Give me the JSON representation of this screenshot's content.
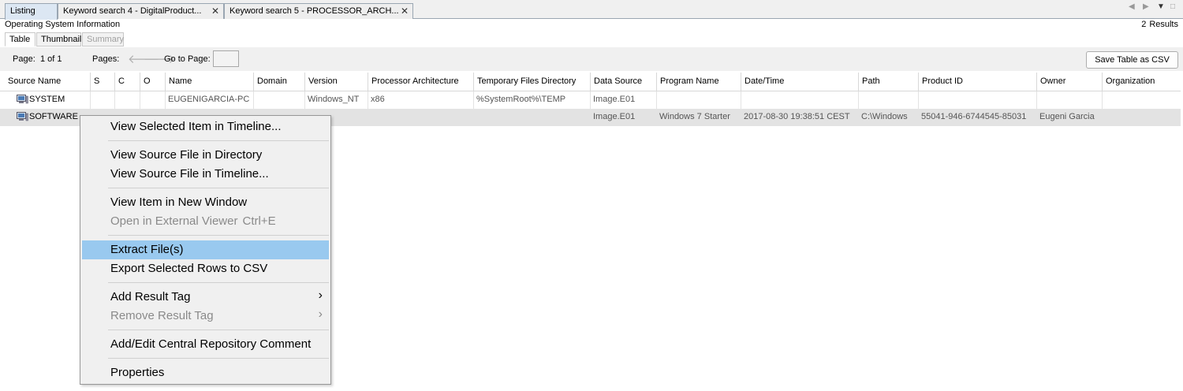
{
  "tabs": [
    {
      "label": "Listing"
    },
    {
      "label": "Keyword search 4 - DigitalProduct..."
    },
    {
      "label": "Keyword search 5 - PROCESSOR_ARCH..."
    }
  ],
  "window_controls": {
    "prev": "◀",
    "next": "▶",
    "menu": "▼",
    "restore": "□"
  },
  "section_title": "Operating System Information",
  "results": {
    "count": "2",
    "label": "Results"
  },
  "subtabs": [
    {
      "label": "Table"
    },
    {
      "label": "Thumbnail"
    },
    {
      "label": "Summary"
    }
  ],
  "pager": {
    "page_label": "Page:",
    "page_value": "1 of 1",
    "pages_label": "Pages:",
    "goto_label": "Go to Page:",
    "goto_value": "",
    "save_csv": "Save Table as CSV"
  },
  "columns": [
    "Source Name",
    "S",
    "C",
    "O",
    "Name",
    "Domain",
    "Version",
    "Processor Architecture",
    "Temporary Files Directory",
    "Data Source",
    "Program Name",
    "Date/Time",
    "Path",
    "Product ID",
    "Owner",
    "Organization"
  ],
  "rows": [
    {
      "source": "SYSTEM",
      "s": "",
      "c": "",
      "o": "",
      "name": "EUGENIGARCIA-PC",
      "domain": "",
      "version": "Windows_NT",
      "arch": "x86",
      "tempdir": "%SystemRoot%\\TEMP",
      "datasource": "Image.E01",
      "program": "",
      "datetime": "",
      "path": "",
      "productid": "",
      "owner": "",
      "org": ""
    },
    {
      "source": "SOFTWARE",
      "s": "",
      "c": "",
      "o": "",
      "name": "",
      "domain": "",
      "version": "",
      "arch": "",
      "tempdir": "",
      "datasource": "Image.E01",
      "program": "Windows 7 Starter",
      "datetime": "2017-08-30 19:38:51 CEST",
      "path": "C:\\Windows",
      "productid": "55041-946-6744545-85031",
      "owner": "Eugeni Garcia",
      "org": ""
    }
  ],
  "context_menu": {
    "view_timeline": "View Selected Item in Timeline...",
    "view_source_dir": "View Source File in Directory",
    "view_source_timeline": "View Source File in Timeline...",
    "view_new_window": "View Item in New Window",
    "open_external": "Open in External Viewer",
    "open_external_shortcut": "Ctrl+E",
    "extract": "Extract File(s)",
    "export_csv": "Export Selected Rows to CSV",
    "add_tag": "Add Result Tag",
    "remove_tag": "Remove Result Tag",
    "central_repo": "Add/Edit Central Repository Comment",
    "properties": "Properties",
    "submenu_glyph": "›"
  },
  "colors": {
    "highlight": "#99c9ef",
    "selected_row": "#e3e3e3",
    "active_tab": "#dce7f3"
  }
}
